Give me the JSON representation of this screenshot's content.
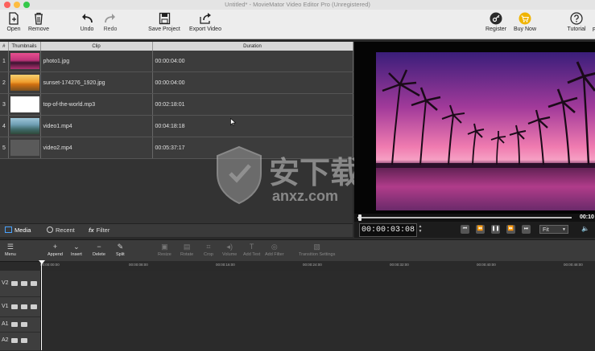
{
  "window": {
    "title": "Untitled* - MovieMator Video Editor Pro (Unregistered)",
    "traffic_colors": [
      "#fc615d",
      "#fdbc40",
      "#34c84a"
    ]
  },
  "toolbar": {
    "open": "Open",
    "remove": "Remove",
    "undo": "Undo",
    "redo": "Redo",
    "save_project": "Save Project",
    "export_video": "Export Video",
    "register": "Register",
    "buy_now": "Buy Now",
    "tutorial": "Tutorial",
    "cut_label": "F"
  },
  "media": {
    "columns": {
      "num": "#",
      "thumbnails": "Thumbnails",
      "clip": "Clip",
      "duration": "Duration"
    },
    "rows": [
      {
        "num": "1",
        "clip": "photo1.jpg",
        "duration": "00:00:04:00",
        "thumb": "sunset-pink"
      },
      {
        "num": "2",
        "clip": "sunset-174276_1920.jpg",
        "duration": "00:00:04:00",
        "thumb": "sunset-gold"
      },
      {
        "num": "3",
        "clip": "top-of-the-world.mp3",
        "duration": "00:02:18:01",
        "thumb": "audio-blank"
      },
      {
        "num": "4",
        "clip": "video1.mp4",
        "duration": "00:04:18:18",
        "thumb": "mountains"
      },
      {
        "num": "5",
        "clip": "video2.mp4",
        "duration": "00:05:37:17",
        "thumb": "gray"
      }
    ]
  },
  "panel_tabs": {
    "media": "Media",
    "recent": "Recent",
    "filter": "Filter",
    "filter_icon_text": "fx"
  },
  "player": {
    "timecode": "00:00:03:08",
    "end_label": "00:10",
    "fit": "Fit",
    "progress": 0.01
  },
  "timeline_toolbar": {
    "menu": "Menu",
    "append": "Append",
    "insert": "Insert",
    "delete": "Delete",
    "split": "Split",
    "resize": "Resize",
    "rotate": "Rotate",
    "crop": "Crop",
    "volume": "Volume",
    "add_text": "Add Text",
    "add_filter": "Add Filter",
    "transition_settings": "Transition Settings"
  },
  "ruler_ticks": [
    "00:00:00:00",
    "00:00:08:00",
    "00:00:16:00",
    "00:00:24:00",
    "00:00:32:00",
    "00:00:40:00",
    "00:00:48:00"
  ],
  "tracks": [
    {
      "label": "V2"
    },
    {
      "label": "V1"
    },
    {
      "label": "A1"
    },
    {
      "label": "A2"
    }
  ],
  "watermark": {
    "title": "安下载",
    "sub": "anxz.com"
  }
}
